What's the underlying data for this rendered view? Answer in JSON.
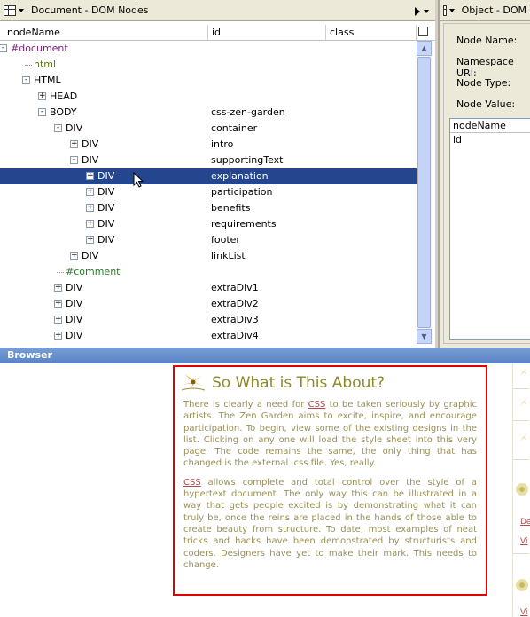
{
  "dom_panel": {
    "title": "Document - DOM Nodes",
    "columns": [
      "nodeName",
      "id",
      "class"
    ],
    "rows": [
      {
        "name": "#document",
        "id": ""
      },
      {
        "name": "html",
        "id": ""
      },
      {
        "name": "HTML",
        "id": ""
      },
      {
        "name": "HEAD",
        "id": ""
      },
      {
        "name": "BODY",
        "id": "css-zen-garden"
      },
      {
        "name": "DIV",
        "id": "container"
      },
      {
        "name": "DIV",
        "id": "intro"
      },
      {
        "name": "DIV",
        "id": "supportingText"
      },
      {
        "name": "DIV",
        "id": "explanation"
      },
      {
        "name": "DIV",
        "id": "participation"
      },
      {
        "name": "DIV",
        "id": "benefits"
      },
      {
        "name": "DIV",
        "id": "requirements"
      },
      {
        "name": "DIV",
        "id": "footer"
      },
      {
        "name": "DIV",
        "id": "linkList"
      },
      {
        "name": "#comment",
        "id": ""
      },
      {
        "name": "DIV",
        "id": "extraDiv1"
      },
      {
        "name": "DIV",
        "id": "extraDiv2"
      },
      {
        "name": "DIV",
        "id": "extraDiv3"
      },
      {
        "name": "DIV",
        "id": "extraDiv4"
      }
    ]
  },
  "object_panel": {
    "title": "Object - DOM",
    "fields": [
      "Node Name:",
      "Namespace URI:",
      "Node Type:",
      "Node Value:"
    ],
    "list_header": "nodeName",
    "list_items": [
      "id"
    ]
  },
  "browser": {
    "bar_label": "Browser",
    "heading": "So What is This About?",
    "para1_prefix": "There is clearly a need for ",
    "para1_link": "CSS",
    "para1_rest": " to be taken seriously by graphic artists. The Zen Garden aims to excite, inspire, and encourage participation. To begin, view some of the existing designs in the list. Clicking on any one will load the style sheet into this very page. The code remains the same, the only thing that has changed is the external .css file. Yes, really.",
    "para2_link": "CSS",
    "para2_rest": " allows complete and total control over the style of a hypertext document. The only way this can be illustrated in a way that gets people excited is by demonstrating what it can truly be, once the reins are placed in the hands of those able to create beauty from structure. To date, most examples of neat tricks and hacks have been demonstrated by structurists and coders. Designers have yet to make their mark. This needs to change.",
    "side_links": [
      "De",
      "Vi",
      "Vi"
    ]
  }
}
